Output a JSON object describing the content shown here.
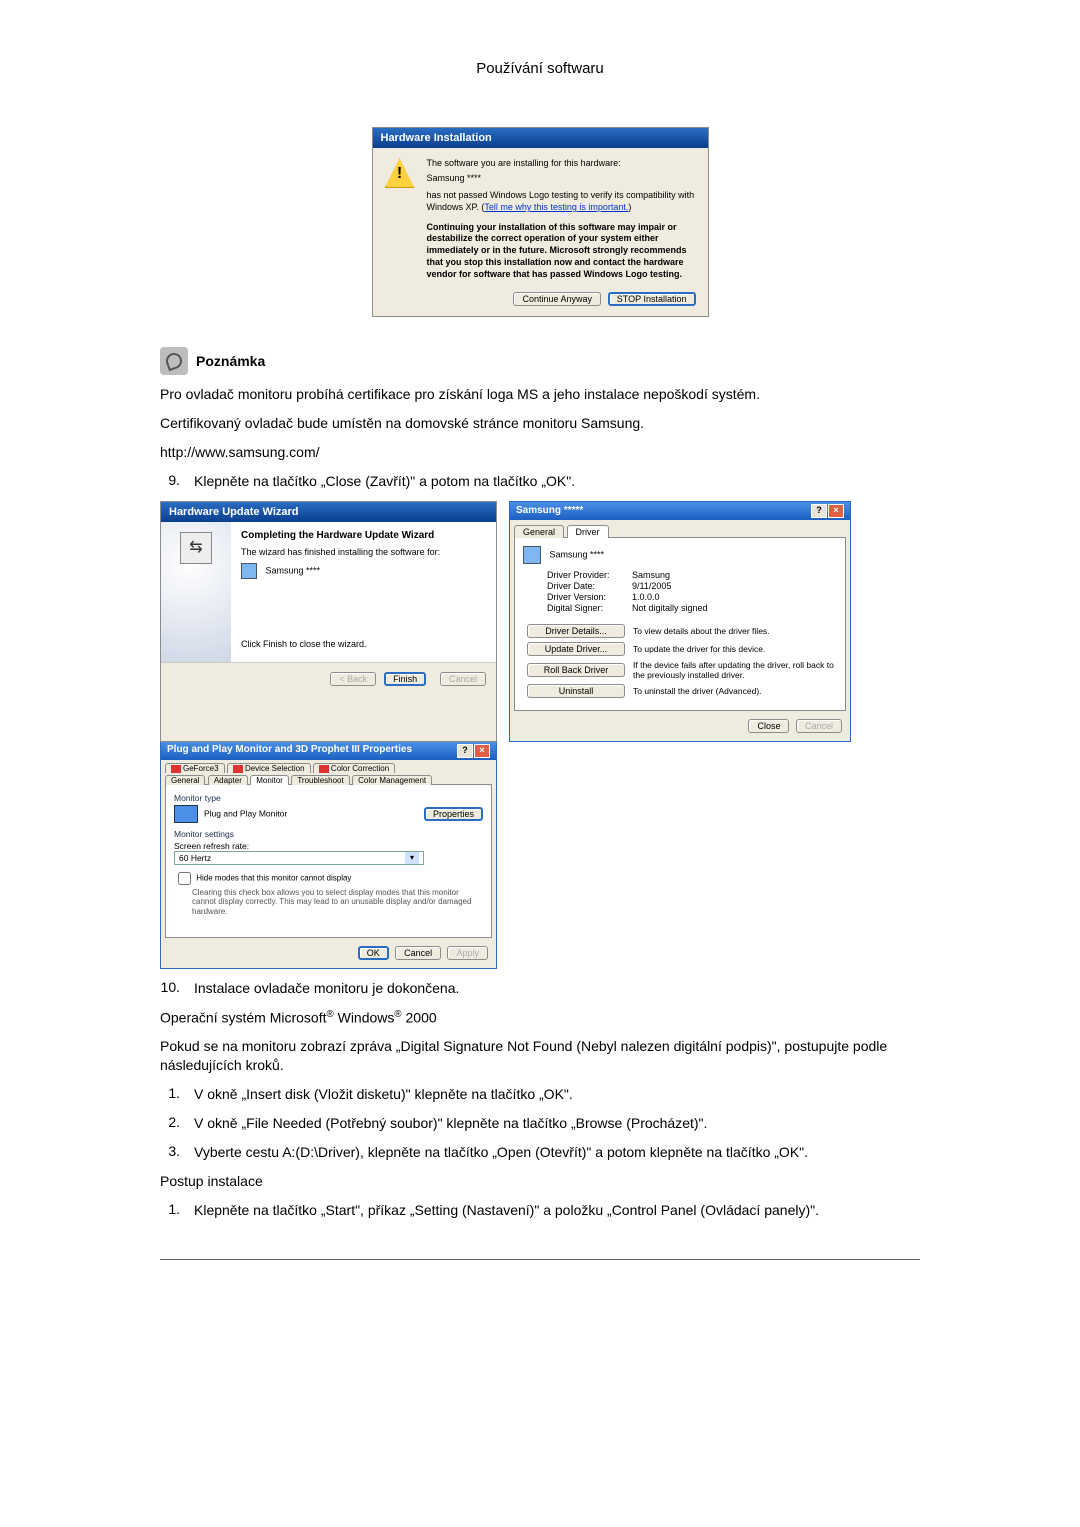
{
  "header": {
    "title": "Používání softwaru"
  },
  "hwInstall": {
    "title": "Hardware Installation",
    "line1": "The software you are installing for this hardware:",
    "device": "Samsung ****",
    "line2a": "has not passed Windows Logo testing to verify its compatibility with Windows XP. (",
    "link": "Tell me why this testing is important.",
    "line2b": ")",
    "warn": "Continuing your installation of this software may impair or destabilize the correct operation of your system either immediately or in the future. Microsoft strongly recommends that you stop this installation now and contact the hardware vendor for software that has passed Windows Logo testing.",
    "btnContinue": "Continue Anyway",
    "btnStop": "STOP Installation"
  },
  "note": {
    "label": "Poznámka",
    "p1": "Pro ovladač monitoru probíhá certifikace pro získání loga MS a jeho instalace nepoškodí systém.",
    "p2": "Certifikovaný ovladač bude umístěn na domovské stránce monitoru Samsung.",
    "url": "http://www.samsung.com/"
  },
  "step9": {
    "num": "9.",
    "text": "Klepněte na tlačítko „Close (Zavřít)\" a potom na tlačítko „OK\"."
  },
  "wizard": {
    "title": "Hardware Update Wizard",
    "heading": "Completing the Hardware Update Wizard",
    "line1": "The wizard has finished installing the software for:",
    "device": "Samsung ****",
    "instr": "Click Finish to close the wizard.",
    "btnBack": "< Back",
    "btnFinish": "Finish",
    "btnCancel": "Cancel"
  },
  "drv": {
    "title": "Samsung *****",
    "tabGeneral": "General",
    "tabDriver": "Driver",
    "device": "Samsung ****",
    "provLabel": "Driver Provider:",
    "provVal": "Samsung",
    "dateLabel": "Driver Date:",
    "dateVal": "9/11/2005",
    "verLabel": "Driver Version:",
    "verVal": "1.0.0.0",
    "sigLabel": "Digital Signer:",
    "sigVal": "Not digitally signed",
    "btnDetails": "Driver Details...",
    "descDetails": "To view details about the driver files.",
    "btnUpdate": "Update Driver...",
    "descUpdate": "To update the driver for this device.",
    "btnRollback": "Roll Back Driver",
    "descRollback": "If the device fails after updating the driver, roll back to the previously installed driver.",
    "btnUninstall": "Uninstall",
    "descUninstall": "To uninstall the driver (Advanced).",
    "btnClose": "Close",
    "btnCancel": "Cancel"
  },
  "mon": {
    "title": "Plug and Play Monitor and 3D Prophet III Properties",
    "tabs": {
      "geforce": "GeForce3",
      "devsel": "Device Selection",
      "colorcorr": "Color Correction",
      "general": "General",
      "adapter": "Adapter",
      "monitor": "Monitor",
      "trouble": "Troubleshoot",
      "colormgmt": "Color Management"
    },
    "sectType": "Monitor type",
    "monName": "Plug and Play Monitor",
    "btnProps": "Properties",
    "sectSettings": "Monitor settings",
    "refreshLabel": "Screen refresh rate:",
    "refreshVal": "60 Hertz",
    "chkLabel": "Hide modes that this monitor cannot display",
    "chkDesc": "Clearing this check box allows you to select display modes that this monitor cannot display correctly. This may lead to an unusable display and/or damaged hardware.",
    "btnOk": "OK",
    "btnCancel": "Cancel",
    "btnApply": "Apply"
  },
  "step10": {
    "num": "10.",
    "text": "Instalace ovladače monitoru je dokončena."
  },
  "osLine": {
    "prefix": "Operační systém Microsoft",
    "reg": "®",
    "mid": " Windows",
    "suffix": " 2000"
  },
  "paraSig": "Pokud se na monitoru zobrazí zpráva „Digital Signature Not Found (Nebyl nalezen digitální podpis)\", postupujte podle následujících kroků.",
  "listA": {
    "n1": "1.",
    "t1": "V okně „Insert disk (Vložit disketu)\" klepněte na tlačítko „OK\".",
    "n2": "2.",
    "t2": "V okně „File Needed (Potřebný soubor)\" klepněte na tlačítko „Browse (Procházet)\".",
    "n3": "3.",
    "t3": "Vyberte cestu A:(D:\\Driver), klepněte na tlačítko „Open (Otevřít)\" a potom klepněte na tlačítko „OK\"."
  },
  "installHdr": "Postup instalace",
  "listB": {
    "n1": "1.",
    "t1": "Klepněte na tlačítko „Start\", příkaz „Setting (Nastavení)\" a položku „Control Panel (Ovládací panely)\"."
  }
}
